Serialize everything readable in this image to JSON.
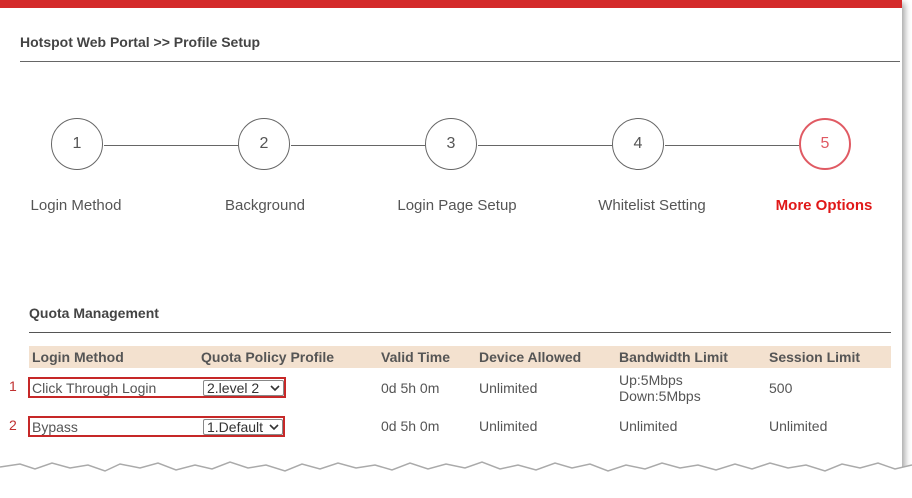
{
  "breadcrumb": "Hotspot Web Portal >> Profile Setup",
  "steps": [
    {
      "number": "1",
      "label": "Login Method"
    },
    {
      "number": "2",
      "label": "Background"
    },
    {
      "number": "3",
      "label": "Login Page Setup"
    },
    {
      "number": "4",
      "label": "Whitelist Setting"
    },
    {
      "number": "5",
      "label": "More Options",
      "active": true
    }
  ],
  "section_title": "Quota Management",
  "table": {
    "headers": [
      "Login Method",
      "Quota Policy Profile",
      "Valid Time",
      "Device Allowed",
      "Bandwidth Limit",
      "Session Limit"
    ],
    "rows": [
      {
        "index": "1",
        "login_method": "Click Through Login",
        "quota_profile": "2.level 2",
        "valid_time": "0d 5h 0m",
        "device_allowed": "Unlimited",
        "bandwidth_up": "Up:5Mbps",
        "bandwidth_down": "Down:5Mbps",
        "session_limit": "500"
      },
      {
        "index": "2",
        "login_method": "Bypass",
        "quota_profile": "1.Default",
        "valid_time": "0d 5h 0m",
        "device_allowed": "Unlimited",
        "bandwidth": "Unlimited",
        "session_limit": "Unlimited"
      }
    ]
  },
  "colors": {
    "accent_bar": "#d42a2a",
    "active_step": "#e01818",
    "header_bg": "#f3e1cf",
    "highlight_box": "#c62828"
  }
}
